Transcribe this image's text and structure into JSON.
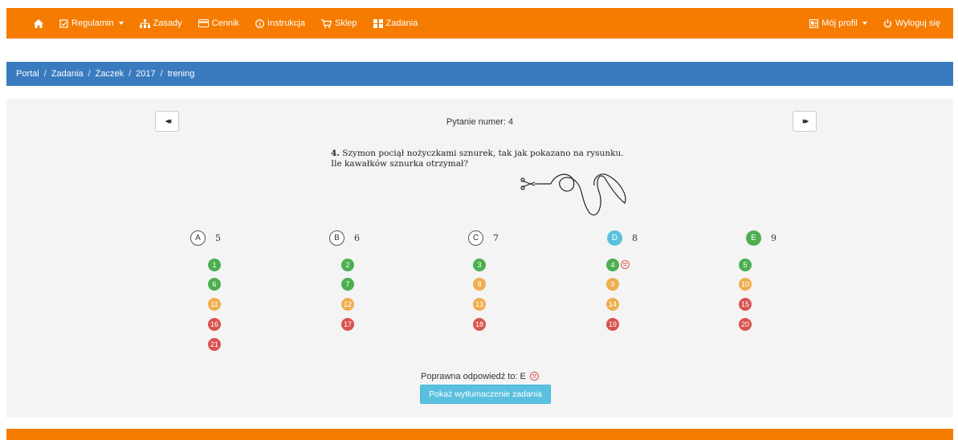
{
  "nav": {
    "home_icon": "home-icon",
    "items": [
      {
        "label": "Regulamin",
        "icon": "clipboard-check-icon",
        "dropdown": true
      },
      {
        "label": "Zasady",
        "icon": "sitemap-icon",
        "dropdown": false
      },
      {
        "label": "Cennik",
        "icon": "credit-card-icon",
        "dropdown": false
      },
      {
        "label": "Instrukcja",
        "icon": "info-circle-icon",
        "dropdown": false
      },
      {
        "label": "Sklep",
        "icon": "cart-icon",
        "dropdown": false
      },
      {
        "label": "Zadania",
        "icon": "grid-icon",
        "dropdown": false
      }
    ],
    "right": [
      {
        "label": "Mój profil",
        "icon": "profile-icon",
        "dropdown": true
      },
      {
        "label": "Wyloguj się",
        "icon": "power-icon",
        "dropdown": false
      }
    ]
  },
  "breadcrumb": [
    "Portal",
    "Zadania",
    "Żaczek",
    "2017",
    "trening"
  ],
  "breadcrumb_separator": "/",
  "question": {
    "header": "Pytanie numer: 4",
    "prev_label": "◀◀",
    "next_label": "▶▶",
    "number": "4.",
    "line1": " Szymon pociął nożyczkami sznurek, tak jak pokazano na rysunku.",
    "line2": "Ile kawałków sznurka otrzymał?"
  },
  "answers": [
    {
      "letter": "A",
      "value": "5",
      "state": "outline"
    },
    {
      "letter": "B",
      "value": "6",
      "state": "outline"
    },
    {
      "letter": "C",
      "value": "7",
      "state": "outline"
    },
    {
      "letter": "D",
      "value": "8",
      "state": "selected"
    },
    {
      "letter": "E",
      "value": "9",
      "state": "correct"
    }
  ],
  "question_grid": [
    {
      "n": "1",
      "status": "correct"
    },
    {
      "n": "2",
      "status": "correct"
    },
    {
      "n": "3",
      "status": "correct"
    },
    {
      "n": "4",
      "status": "correct",
      "wrong_mark": true
    },
    {
      "n": "5",
      "status": "correct"
    },
    {
      "n": "6",
      "status": "correct"
    },
    {
      "n": "7",
      "status": "correct"
    },
    {
      "n": "8",
      "status": "medium"
    },
    {
      "n": "9",
      "status": "medium"
    },
    {
      "n": "10",
      "status": "medium"
    },
    {
      "n": "11",
      "status": "medium"
    },
    {
      "n": "12",
      "status": "medium"
    },
    {
      "n": "13",
      "status": "medium"
    },
    {
      "n": "14",
      "status": "medium"
    },
    {
      "n": "15",
      "status": "hard"
    },
    {
      "n": "16",
      "status": "hard"
    },
    {
      "n": "17",
      "status": "hard"
    },
    {
      "n": "18",
      "status": "hard"
    },
    {
      "n": "19",
      "status": "hard"
    },
    {
      "n": "20",
      "status": "hard"
    },
    {
      "n": "21",
      "status": "hard"
    }
  ],
  "correct_answer_text": "Poprawna odpowiedź to: E",
  "explain_button": "Pokaż wytłumaczenie zadania",
  "colors": {
    "nav": "#f57c00",
    "breadcrumb": "#3a7bbf",
    "green": "#4caf50",
    "orange": "#f0ad4e",
    "red": "#d9534f",
    "blue": "#5bc0de"
  }
}
